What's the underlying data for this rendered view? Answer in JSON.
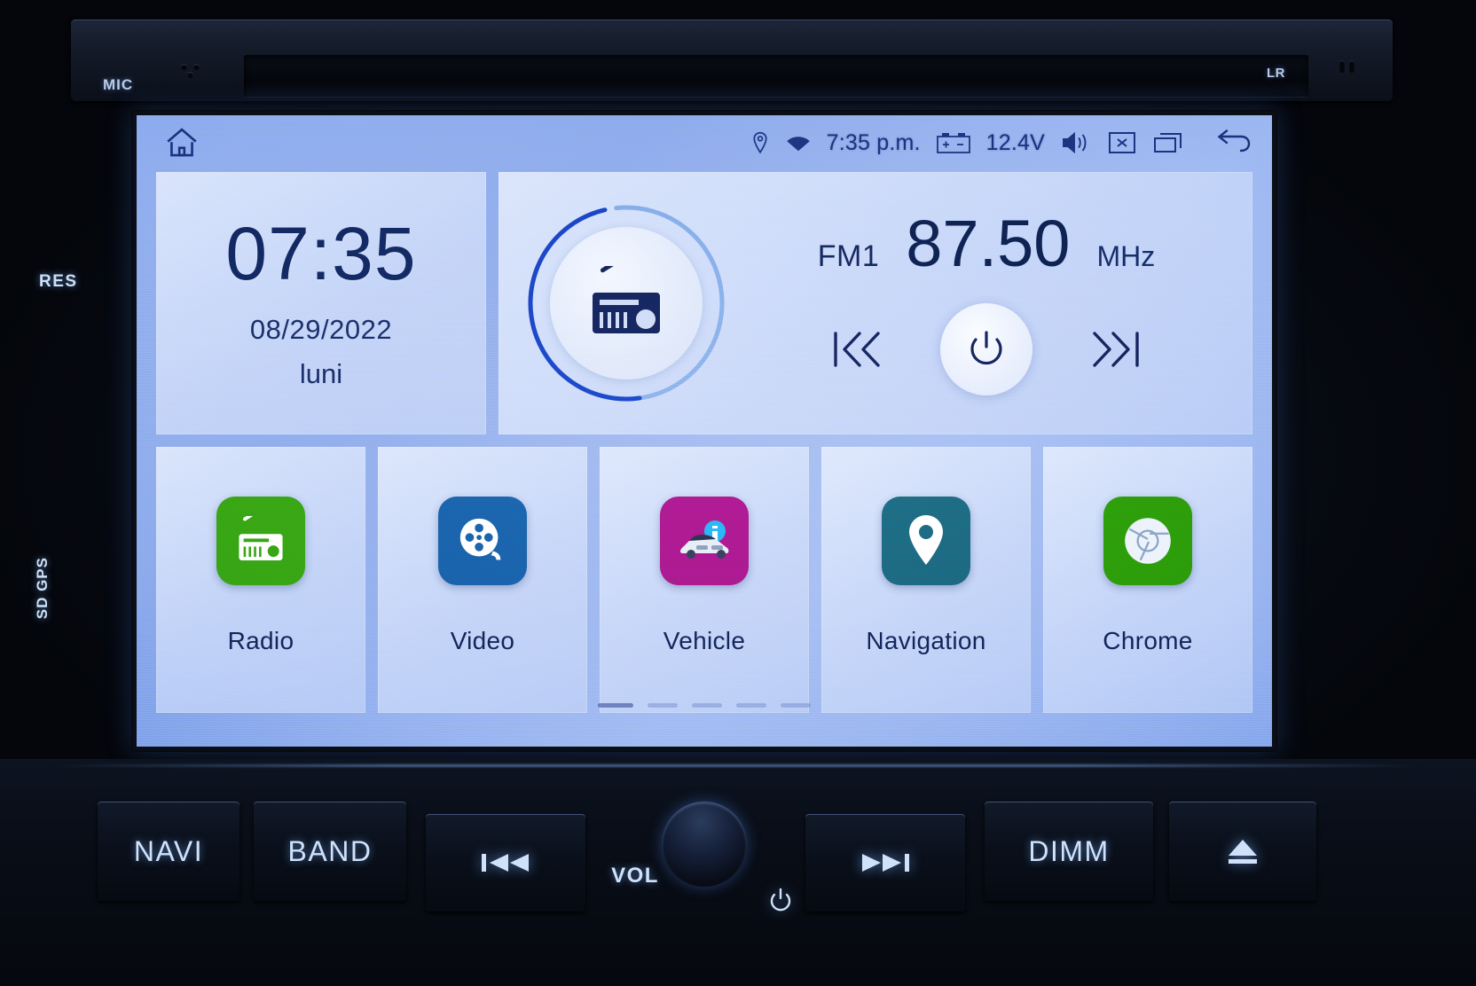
{
  "device": {
    "mic_label": "MIC",
    "lr_label": "LR",
    "res_label": "RES",
    "sd_gps_label": "SD\nGPS"
  },
  "statusbar": {
    "home_icon": "home-icon",
    "location_icon": "location-pin-icon",
    "wifi_icon": "wifi-icon",
    "time": "7:35 p.m.",
    "battery_icon": "car-battery-icon",
    "voltage": "12.4V",
    "volume_icon": "speaker-volume-icon",
    "close_icon": "close-box-icon",
    "recents_icon": "recent-apps-icon",
    "back_icon": "back-arrow-icon"
  },
  "clock_widget": {
    "time": "07:35",
    "date": "08/29/2022",
    "weekday": "luni"
  },
  "radio_widget": {
    "dial_icon": "radio-icon",
    "band": "FM1",
    "frequency": "87.50",
    "unit": "MHz",
    "prev_icon": "skip-previous-icon",
    "power_icon": "power-icon",
    "next_icon": "skip-next-icon",
    "dial_progress_color": "#1b46c8",
    "dial_track_color": "#79a7e8"
  },
  "apps": [
    {
      "label": "Radio",
      "icon": "radio-app-icon",
      "color": "#3aa814"
    },
    {
      "label": "Video",
      "icon": "film-reel-icon",
      "color": "#1a63ab"
    },
    {
      "label": "Vehicle",
      "icon": "car-info-icon",
      "color": "#ad1a8e"
    },
    {
      "label": "Navigation",
      "icon": "map-pin-icon",
      "color": "#1d6b80"
    },
    {
      "label": "Chrome",
      "icon": "chrome-icon",
      "color": "#2fa10a"
    }
  ],
  "pager": {
    "pages": 5,
    "active_index": 0
  },
  "hard_buttons": {
    "navi": "NAVI",
    "band": "BAND",
    "prev_icon": "track-previous-icon",
    "next_icon": "track-next-icon",
    "vol_label": "VOL",
    "power_icon": "power-icon",
    "dimm": "DIMM",
    "eject_icon": "eject-icon"
  }
}
